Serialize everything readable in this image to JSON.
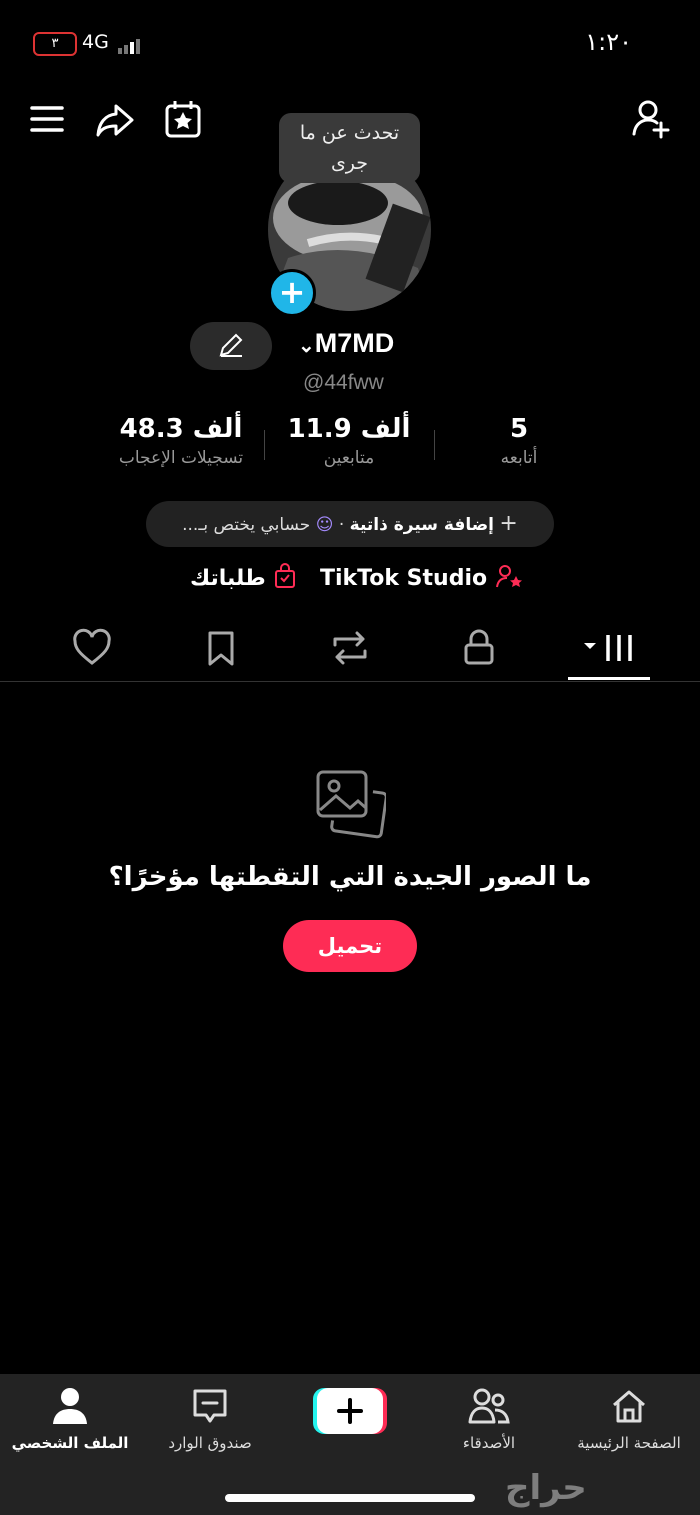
{
  "status": {
    "time": "١:٢٠",
    "battery": "٣",
    "network": "4G"
  },
  "tooltip": {
    "text": "تحدث عن ما جرى"
  },
  "profile": {
    "username": "M7MD",
    "handle": "@44fww"
  },
  "stats": [
    {
      "value": "48.3 ألف",
      "label": "تسجيلات الإعجاب"
    },
    {
      "value": "11.9 ألف",
      "label": "متابعين"
    },
    {
      "value": "5",
      "label": "أتابعه"
    }
  ],
  "bio": {
    "add": "إضافة سيرة ذاتية",
    "extra": "حسابي يختص بـ..."
  },
  "links": {
    "studio": "TikTok Studio",
    "orders": "طلباتك"
  },
  "empty_state": {
    "text": "ما الصور الجيدة التي التقطتها مؤخرًا؟",
    "button": "تحميل"
  },
  "nav": {
    "home": "الصفحة الرئيسية",
    "friends": "الأصدقاء",
    "inbox": "صندوق الوارد",
    "profile": "الملف الشخصي"
  },
  "watermark": "حراج",
  "colors": {
    "accent": "#fe2c55",
    "plus": "#20b6e8",
    "bg": "#000000"
  }
}
